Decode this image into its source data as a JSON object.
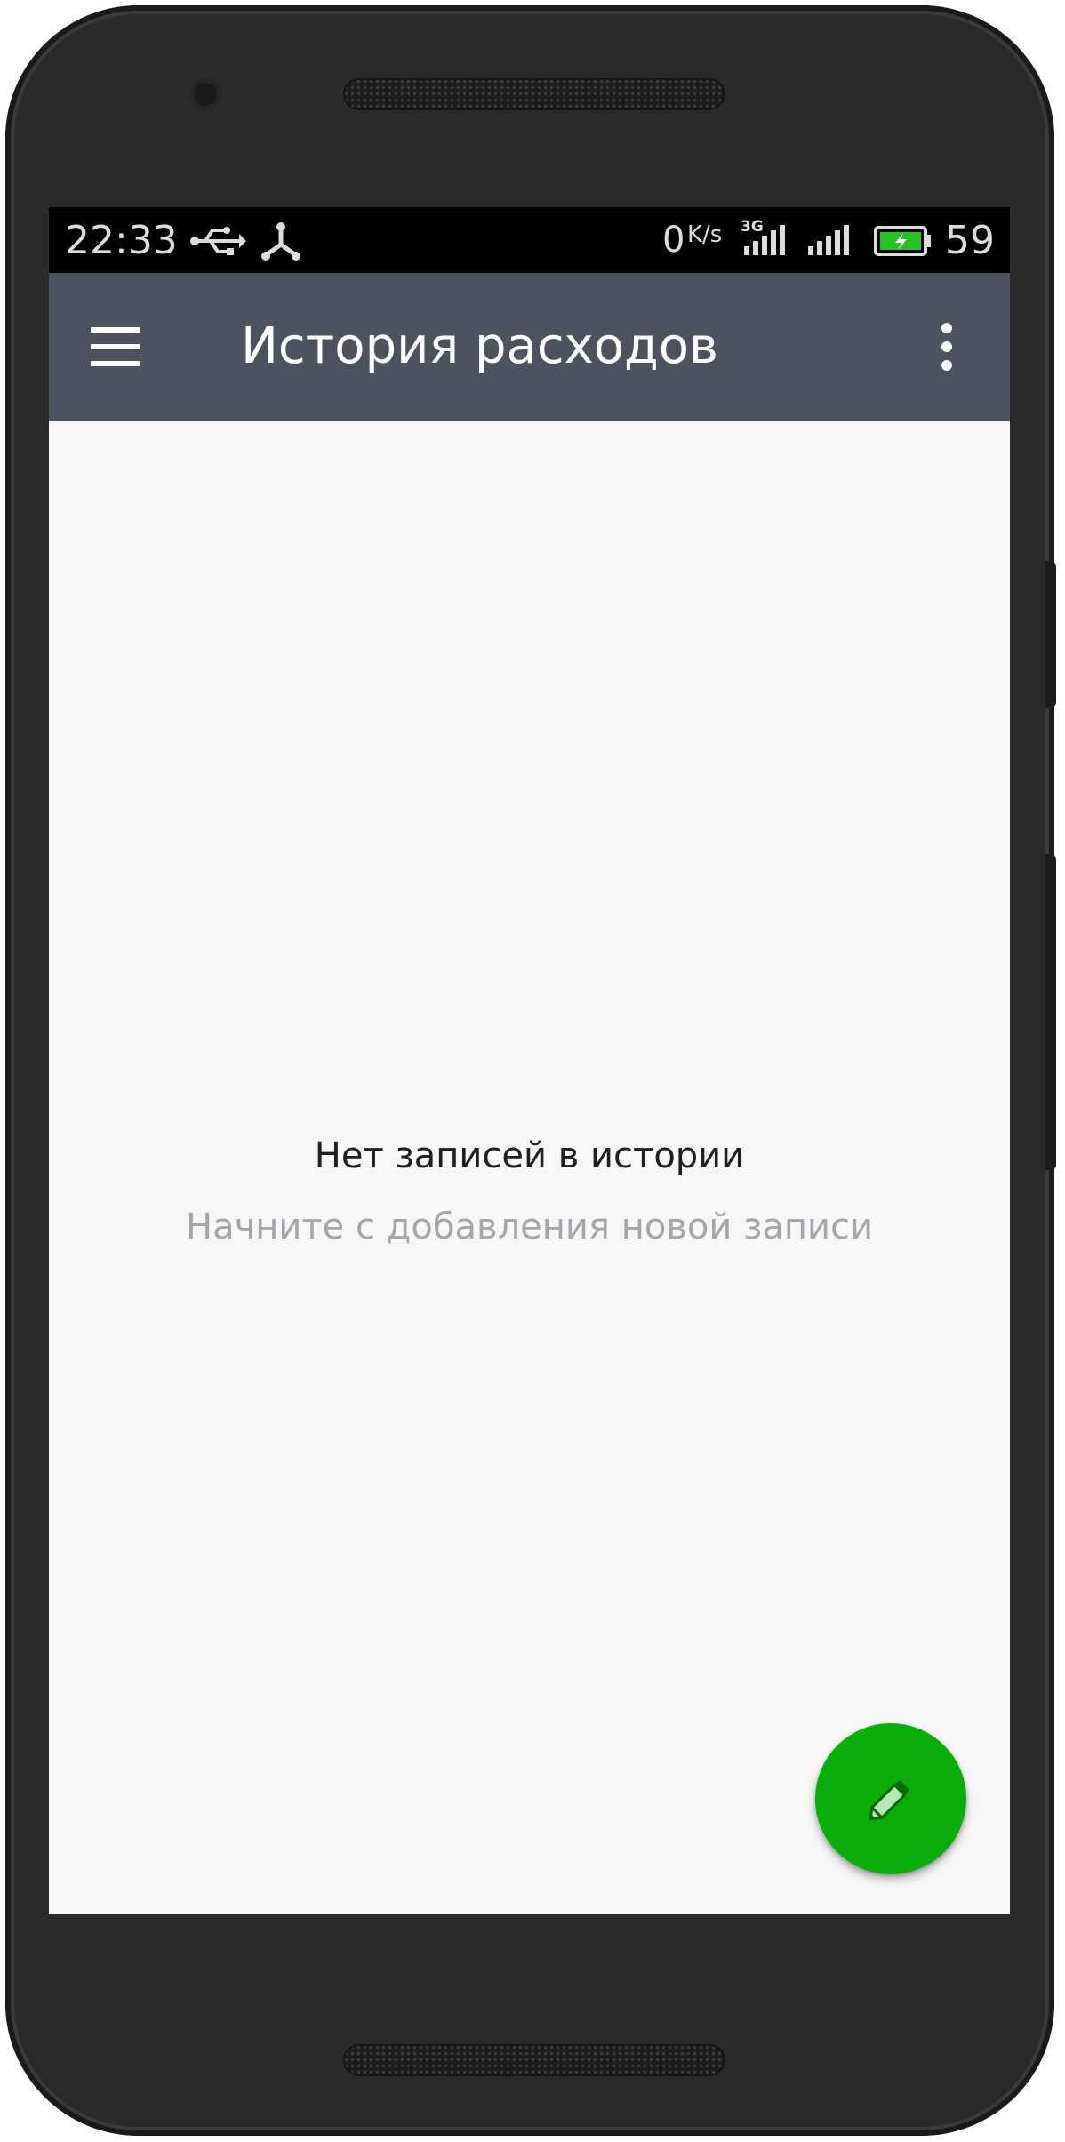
{
  "status_bar": {
    "time": "22:33",
    "net_speed_value": "0",
    "net_speed_unit": "K/s",
    "network_type": "3G",
    "battery_level": "59",
    "icons": [
      "usb-icon",
      "share-icon",
      "signal-3g-icon",
      "signal-icon",
      "battery-charging-icon"
    ]
  },
  "app_bar": {
    "title": "История расходов",
    "menu_icon": "hamburger-menu-icon",
    "overflow_icon": "more-vert-icon",
    "color": "#4d5260"
  },
  "empty_state": {
    "title": "Нет записей в истории",
    "subtitle": "Начните с добавления новой записи"
  },
  "fab": {
    "icon": "pencil-icon",
    "color": "#0aae0a"
  }
}
